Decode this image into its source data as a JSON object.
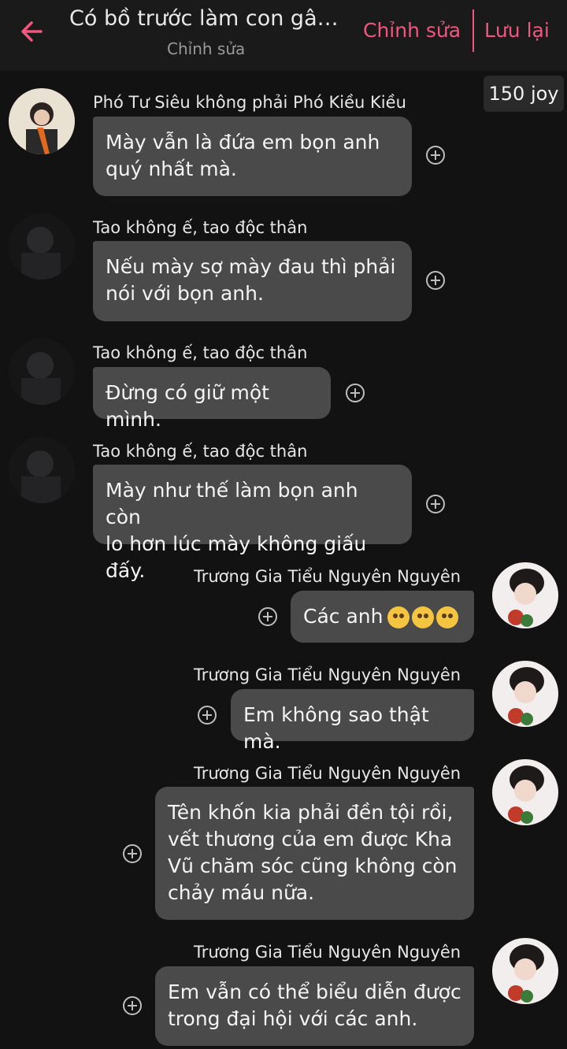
{
  "header": {
    "title": "Có bồ trước làm con gâ…",
    "subtitle": "Chỉnh sửa",
    "edit_label": "Chỉnh sửa",
    "save_label": "Lưu lại",
    "accent_color": "#f0567f"
  },
  "joy_badge": "150 joy",
  "messages": [
    {
      "sender": "Phó Tư Siêu không phải Phó Kiều Kiều",
      "text_lines": [
        "Mày vẫn là đứa em bọn anh",
        "quý nhất mà."
      ],
      "side": "left"
    },
    {
      "sender": "Tao không ế, tao độc thân",
      "text_lines": [
        "Nếu mày sợ mày đau thì phải",
        "nói với bọn anh."
      ],
      "side": "left"
    },
    {
      "sender": "Tao không ế, tao độc thân",
      "text_lines": [
        "Đừng có giữ một mình."
      ],
      "side": "left"
    },
    {
      "sender": "Tao không ế, tao độc thân",
      "text_lines": [
        "Mày như thế làm bọn anh còn",
        "lo hơn lúc mày không giấu đấy."
      ],
      "side": "left"
    },
    {
      "sender": "Trương Gia Tiểu Nguyên Nguyên",
      "text_lines": [
        "Các anh"
      ],
      "emojis": [
        "pleading-face",
        "pleading-face",
        "pleading-face"
      ],
      "side": "right"
    },
    {
      "sender": "Trương Gia Tiểu Nguyên Nguyên",
      "text_lines": [
        "Em không sao thật mà."
      ],
      "side": "right"
    },
    {
      "sender": "Trương Gia Tiểu Nguyên Nguyên",
      "text_lines": [
        "Tên khốn kia phải đền tội rồi,",
        "vết thương của em được Kha",
        "Vũ chăm sóc cũng không còn",
        "chảy máu nữa."
      ],
      "side": "right"
    },
    {
      "sender": "Trương Gia Tiểu Nguyên Nguyên",
      "text_lines": [
        "Em vẫn có thể biểu diễn được",
        "trong đại hội với các anh."
      ],
      "side": "right"
    }
  ]
}
